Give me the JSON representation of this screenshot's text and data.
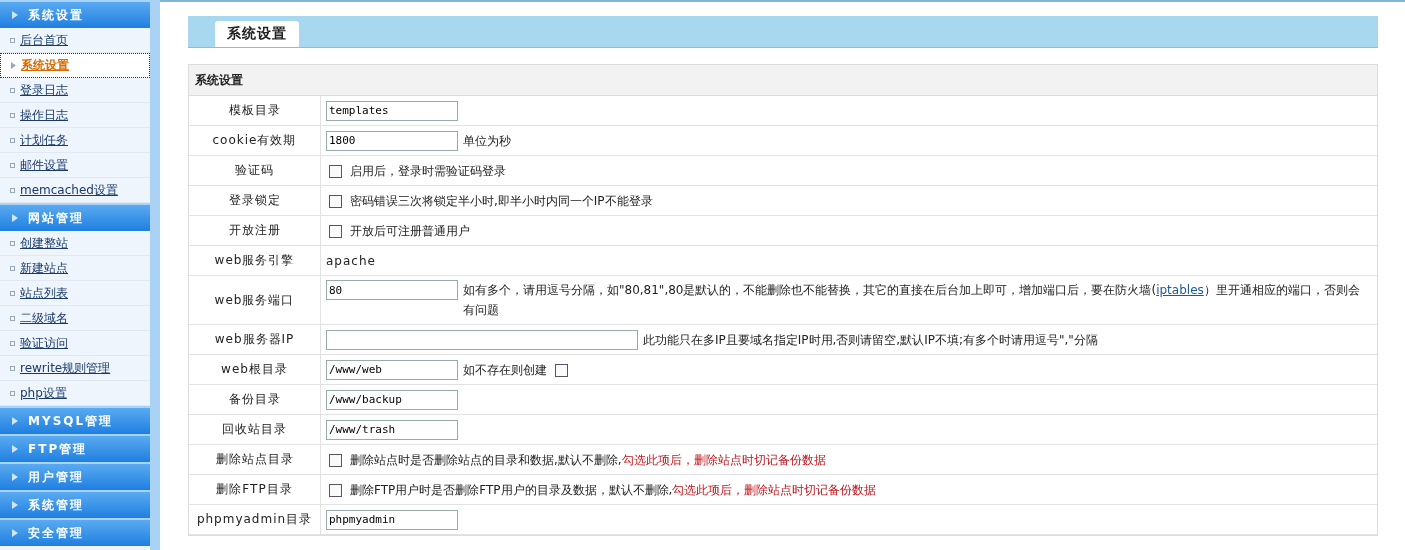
{
  "sidebar": {
    "groups": [
      {
        "title": "系统设置",
        "items": [
          {
            "label": "后台首页",
            "selected": false
          },
          {
            "label": "系统设置",
            "selected": true
          },
          {
            "label": "登录日志",
            "selected": false
          },
          {
            "label": "操作日志",
            "selected": false
          },
          {
            "label": "计划任务",
            "selected": false
          },
          {
            "label": "邮件设置",
            "selected": false
          },
          {
            "label": "memcached设置",
            "selected": false
          }
        ]
      },
      {
        "title": "网站管理",
        "items": [
          {
            "label": "创建整站",
            "selected": false
          },
          {
            "label": "新建站点",
            "selected": false
          },
          {
            "label": "站点列表",
            "selected": false
          },
          {
            "label": "二级域名",
            "selected": false
          },
          {
            "label": "验证访问",
            "selected": false
          },
          {
            "label": "rewrite规则管理",
            "selected": false
          },
          {
            "label": "php设置",
            "selected": false
          }
        ]
      },
      {
        "title": "MYSQL管理"
      },
      {
        "title": "FTP管理"
      },
      {
        "title": "用户管理"
      },
      {
        "title": "系统管理"
      },
      {
        "title": "安全管理"
      }
    ]
  },
  "tab": {
    "label": "系统设置"
  },
  "form": {
    "title": "系统设置",
    "rows": [
      {
        "label": "模板目录",
        "parts": [
          {
            "kind": "input",
            "value": "templates"
          }
        ]
      },
      {
        "label": "cookie有效期",
        "parts": [
          {
            "kind": "input",
            "value": "1800"
          },
          {
            "kind": "note",
            "segments": [
              {
                "kind": "plain",
                "text": "单位为秒"
              }
            ]
          }
        ]
      },
      {
        "label": "验证码",
        "parts": [
          {
            "kind": "checkbox",
            "checked": false
          },
          {
            "kind": "note",
            "segments": [
              {
                "kind": "plain",
                "text": "启用后，登录时需验证码登录"
              }
            ]
          }
        ]
      },
      {
        "label": "登录锁定",
        "parts": [
          {
            "kind": "checkbox",
            "checked": false
          },
          {
            "kind": "note",
            "segments": [
              {
                "kind": "plain",
                "text": "密码错误三次将锁定半小时,即半小时内同一个IP不能登录"
              }
            ]
          }
        ]
      },
      {
        "label": "开放注册",
        "parts": [
          {
            "kind": "checkbox",
            "checked": false
          },
          {
            "kind": "note",
            "segments": [
              {
                "kind": "plain",
                "text": "开放后可注册普通用户"
              }
            ]
          }
        ]
      },
      {
        "label": "web服务引擎",
        "parts": [
          {
            "kind": "text",
            "text": "apache"
          }
        ]
      },
      {
        "label": "web服务端口",
        "parts": [
          {
            "kind": "input",
            "value": "80"
          },
          {
            "kind": "note",
            "segments": [
              {
                "kind": "plain",
                "text": "如有多个，请用逗号分隔，如\"80,81\",80是默认的，不能删除也不能替换，其它的直接在后台加上即可，增加端口后，要在防火墙("
              },
              {
                "kind": "link",
                "text": "iptables"
              },
              {
                "kind": "plain",
                "text": "）里开通相应的端口，否则会有问题"
              }
            ]
          }
        ]
      },
      {
        "label": "web服务器IP",
        "parts": [
          {
            "kind": "input",
            "wide": true
          },
          {
            "kind": "note",
            "segments": [
              {
                "kind": "plain",
                "text": "此功能只在多IP且要域名指定IP时用,否则请留空,默认IP不填;有多个时请用逗号\",\"分隔"
              }
            ]
          }
        ]
      },
      {
        "label": "web根目录",
        "parts": [
          {
            "kind": "input",
            "value": "/www/web"
          },
          {
            "kind": "note",
            "segments": [
              {
                "kind": "plain",
                "text": "如不存在则创建"
              }
            ]
          },
          {
            "kind": "checkbox",
            "checked": false
          }
        ]
      },
      {
        "label": "备份目录",
        "parts": [
          {
            "kind": "input",
            "value": "/www/backup"
          }
        ]
      },
      {
        "label": "回收站目录",
        "parts": [
          {
            "kind": "input",
            "value": "/www/trash"
          }
        ]
      },
      {
        "label": "删除站点目录",
        "parts": [
          {
            "kind": "checkbox",
            "checked": false
          },
          {
            "kind": "note",
            "segments": [
              {
                "kind": "plain",
                "text": "删除站点时是否删除站点的目录和数据,默认不删除,"
              },
              {
                "kind": "warning",
                "text": "勾选此项后，删除站点时切记备份数据"
              }
            ]
          }
        ]
      },
      {
        "label": "删除FTP目录",
        "parts": [
          {
            "kind": "checkbox",
            "checked": false
          },
          {
            "kind": "note",
            "segments": [
              {
                "kind": "plain",
                "text": "删除FTP用户时是否删除FTP用户的目录及数据，默认不删除,"
              },
              {
                "kind": "warning",
                "text": "勾选此项后，删除站点时切记备份数据"
              }
            ]
          }
        ]
      },
      {
        "label": "phpmyadmin目录",
        "parts": [
          {
            "kind": "input",
            "value": "phpmyadmin"
          }
        ]
      }
    ]
  }
}
